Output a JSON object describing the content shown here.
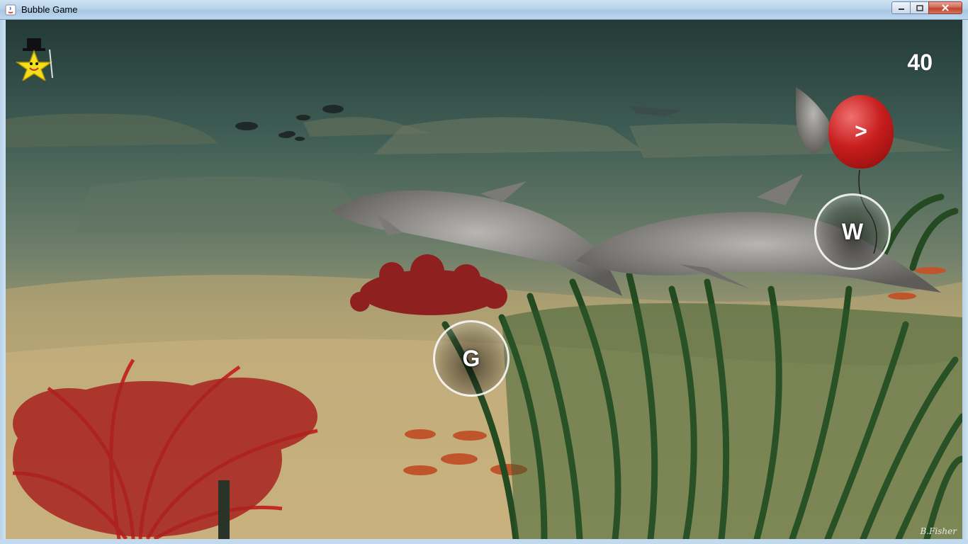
{
  "window": {
    "title": "Bubble Game",
    "controls": {
      "minimize": "minimize",
      "maximize": "maximize",
      "close": "close"
    }
  },
  "hud": {
    "score": "40",
    "mascot_icon": "star-with-top-hat-icon"
  },
  "bubbles": [
    {
      "letter": "G"
    },
    {
      "letter": "W"
    }
  ],
  "balloon": {
    "label": ">",
    "color": "#c81e1e"
  },
  "signature": "B.Fisher",
  "colors": {
    "water": "#2f4a44",
    "sand": "#c9b27a",
    "bubble_ring": "#ffffff"
  }
}
